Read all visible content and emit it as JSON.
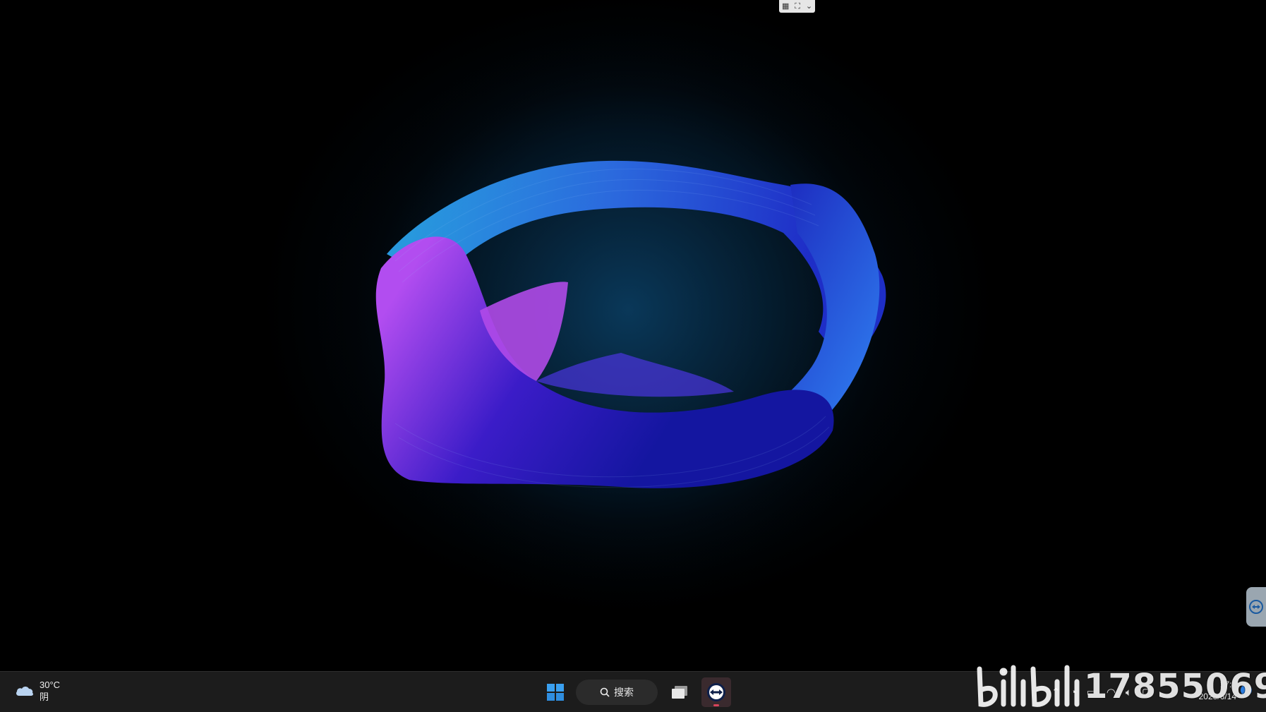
{
  "taskbar": {
    "weather": {
      "temperature": "30°C",
      "condition": "阴",
      "icon": "cloud-icon"
    },
    "search": {
      "label": "搜索"
    },
    "apps": [
      {
        "name": "task-view-icon"
      },
      {
        "name": "teamviewer-icon",
        "active": true
      }
    ],
    "clock": {
      "time": "17:3",
      "date": "2023/6/14"
    }
  },
  "watermark": {
    "brand": "bilibili",
    "id": "17855069"
  },
  "colors": {
    "taskbar": "#1c1c1c",
    "accent_blue": "#2a7de1",
    "indicator": "#d8445c"
  }
}
